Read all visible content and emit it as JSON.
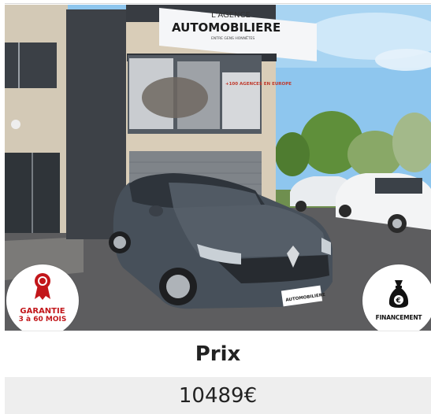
{
  "photo": {
    "dealer_sign_line1": "L'AGENCE",
    "dealer_sign_line2": "AUTOMOBILIERE",
    "dealer_sign_tagline": "ENTRE GENS HONNÊTES",
    "window_poster_text": "+100 AGENCES EN EUROPE",
    "plate_text": "AUTOMOBILIERE"
  },
  "badges": {
    "warranty_line1": "GARANTIE",
    "warranty_line2": "3 à 60 MOIS",
    "warranty_icon": "ribbon-medal-icon",
    "warranty_color": "#c2161a",
    "financing_label": "FINANCEMENT",
    "financing_icon": "money-bag-euro-icon"
  },
  "price": {
    "label": "Prix",
    "value": "10489€"
  }
}
